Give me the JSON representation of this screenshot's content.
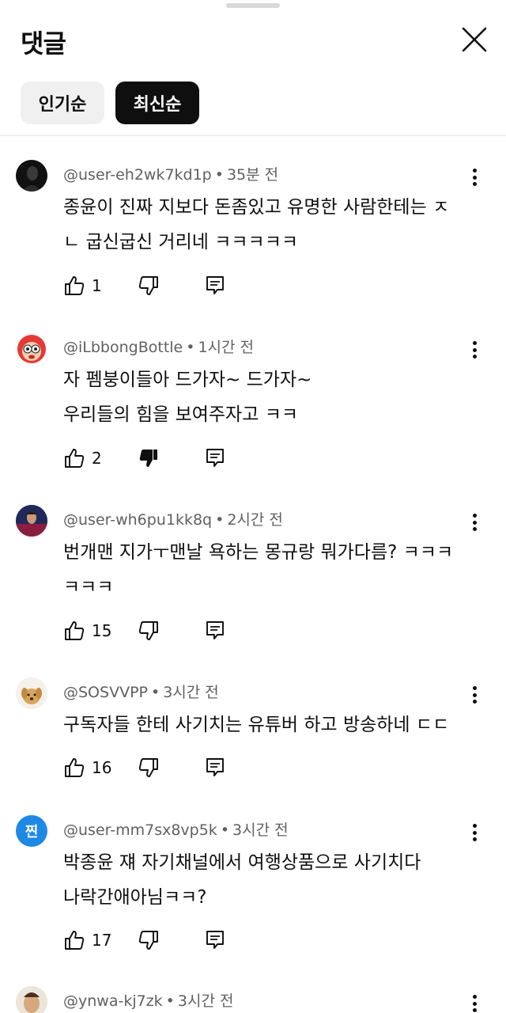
{
  "header": {
    "title": "댓글"
  },
  "filters": [
    {
      "label": "인기순",
      "selected": false
    },
    {
      "label": "최신순",
      "selected": true
    }
  ],
  "avatar_letters": {
    "c5": "찐"
  },
  "comments": [
    {
      "author": "@user-eh2wk7kd1p",
      "time": "35분 전",
      "line1": "종윤이 진짜 지보다 돈좀있고 유명한 사람한테는 ㅈ",
      "line2": "ㄴ 굽신굽신 거리네 ㅋㅋㅋㅋㅋ",
      "likes": "1",
      "disliked": false
    },
    {
      "author": "@iLbbongBottle",
      "time": "1시간 전",
      "line1": "자 펨붕이들아 드가자~ 드가자~",
      "line2": "우리들의 힘을 보여주자고 ㅋㅋ",
      "likes": "2",
      "disliked": true
    },
    {
      "author": "@user-wh6pu1kk8q",
      "time": "2시간 전",
      "line1": "번개맨 지가ㅜ맨날 욕하는 몽규랑 뭐가다름? ㅋㅋㅋ",
      "line2": "ㅋㅋㅋ",
      "likes": "15",
      "disliked": false
    },
    {
      "author": "@SOSVVPP",
      "time": "3시간 전",
      "line1": "구독자들 한테 사기치는 유튜버 하고 방송하네 ㄷㄷ",
      "likes": "16",
      "disliked": false
    },
    {
      "author": "@user-mm7sx8vp5k",
      "time": "3시간 전",
      "line1": "박종윤 쟤 자기채널에서 여행상품으로 사기치다",
      "line2": "나락간애아님ㅋㅋ?",
      "likes": "17",
      "disliked": false
    },
    {
      "author": "@ynwa-kj7zk",
      "time": "3시간 전"
    }
  ],
  "colors": {
    "text": "#0f0f0f",
    "meta": "#606060",
    "chip_bg": "#f0f0f0",
    "chip_selected_bg": "#0f0f0f",
    "avatar_c5": "#1e88e5"
  }
}
